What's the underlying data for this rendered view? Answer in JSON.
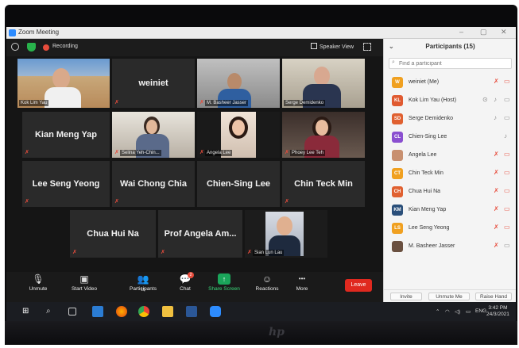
{
  "window": {
    "title": "Zoom Meeting",
    "min": "–",
    "max": "▢",
    "close": "✕"
  },
  "topbar": {
    "recording": "Recording",
    "speaker_view": "Speaker View"
  },
  "tiles": {
    "kok_lim_yau": "Kok Lim Yau",
    "weiniet": "weiniet",
    "basheer": "M. Basheer Jasser",
    "serge": "Serge Demidenko",
    "kian": "Kian Meng Yap",
    "selina": "Selina Yeh-Chin...",
    "angela": "Angela Lee",
    "phoey": "Phoey Lee Teh",
    "lee_seng": "Lee Seng Yeong",
    "wai_chong": "Wai Chong Chia",
    "chien_sing": "Chien-Sing Lee",
    "chin_teck": "Chin Teck Min",
    "chua": "Chua Hui Na",
    "prof_angela": "Prof Angela Am...",
    "sian_lun": "Sian Lun Lau"
  },
  "toolbar": {
    "unmute": "Unmute",
    "start_video": "Start Video",
    "participants": "Participants",
    "participants_count": "15",
    "chat": "Chat",
    "chat_badge": "2",
    "share_screen": "Share Screen",
    "reactions": "Reactions",
    "more": "More",
    "more_icon": "•••",
    "leave": "Leave"
  },
  "panel": {
    "title": "Participants (15)",
    "search_placeholder": "Find a participant",
    "participants": [
      {
        "initials": "W",
        "name": "weiniet (Me)",
        "color": "#f0a020"
      },
      {
        "initials": "KL",
        "name": "Kok Lim Yau (Host)",
        "color": "#e05a30"
      },
      {
        "initials": "SD",
        "name": "Serge Demidenko",
        "color": "#e06030"
      },
      {
        "initials": "CL",
        "name": "Chien-Sing Lee",
        "color": "#8a4fd0"
      },
      {
        "initials": "",
        "name": "Angela Lee",
        "color": "#c89070"
      },
      {
        "initials": "CT",
        "name": "Chin Teck Min",
        "color": "#f0a020"
      },
      {
        "initials": "CH",
        "name": "Chua Hui Na",
        "color": "#e06030"
      },
      {
        "initials": "KM",
        "name": "Kian Meng Yap",
        "color": "#2a4f7a"
      },
      {
        "initials": "LS",
        "name": "Lee Seng Yeong",
        "color": "#f0a020"
      },
      {
        "initials": "",
        "name": "M. Basheer Jasser",
        "color": "#6a5040"
      }
    ],
    "invite": "Invite",
    "unmute_me": "Unmute Me",
    "raise_hand": "Raise Hand"
  },
  "taskbar": {
    "lang": "ENG",
    "time": "3:42 PM",
    "date": "24/3/2021"
  }
}
